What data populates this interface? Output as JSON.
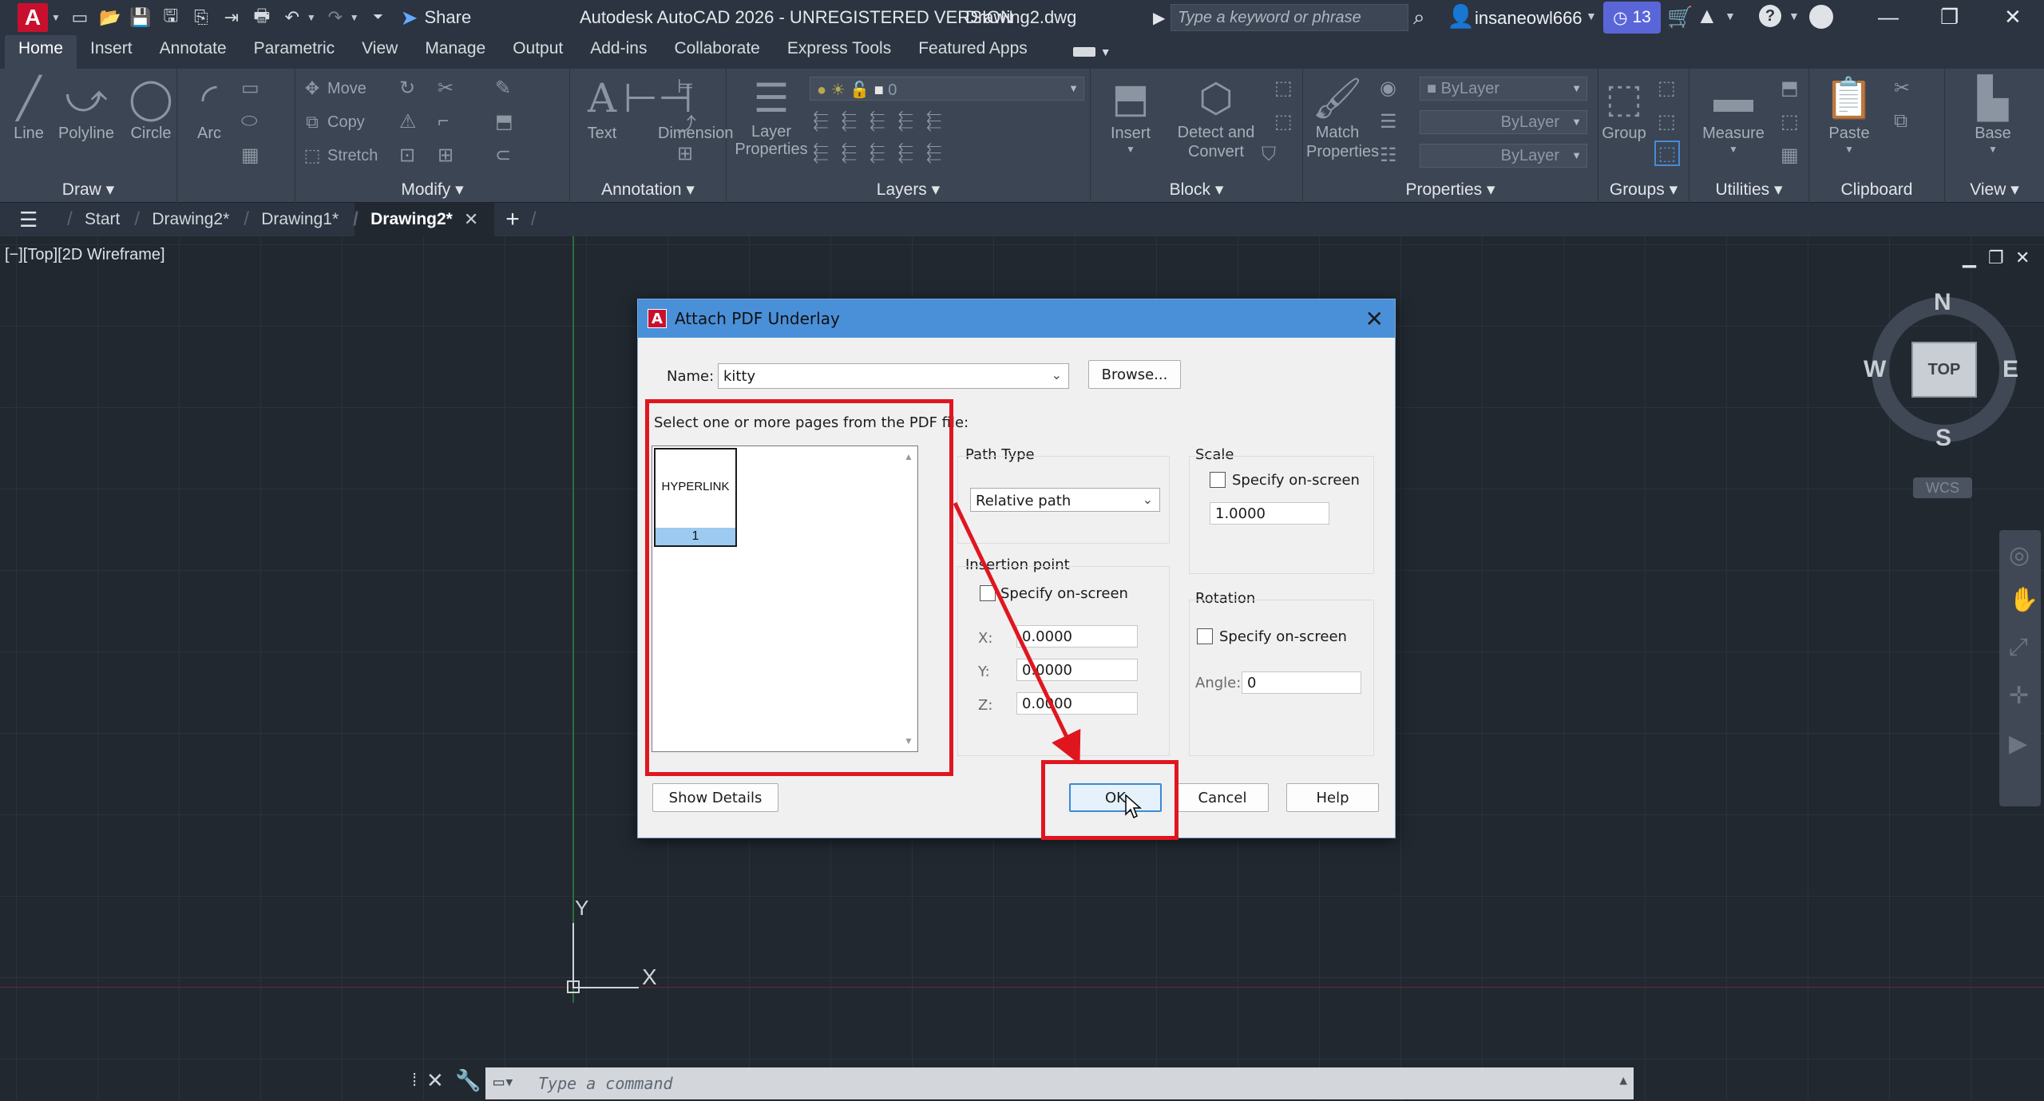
{
  "titlebar": {
    "share_label": "Share",
    "app_title": "Autodesk AutoCAD 2026 - UNREGISTERED VERSION",
    "doc_title": "Drawing2.dwg",
    "search_placeholder": "Type a keyword or phrase",
    "user_name": "insaneowl666",
    "notification_count": "13"
  },
  "ribbon_tabs": [
    "Home",
    "Insert",
    "Annotate",
    "Parametric",
    "View",
    "Manage",
    "Output",
    "Add-ins",
    "Collaborate",
    "Express Tools",
    "Featured Apps"
  ],
  "active_ribbon_tab": "Home",
  "ribbon": {
    "draw": {
      "label": "Draw",
      "tools": [
        "Line",
        "Polyline",
        "Circle",
        "Arc"
      ]
    },
    "modify": {
      "label": "Modify",
      "tools": [
        "Move",
        "Copy",
        "Stretch"
      ]
    },
    "annotation": {
      "label": "Annotation",
      "tools": [
        "Text",
        "Dimension"
      ]
    },
    "layers": {
      "label": "Layers",
      "tool": "Layer",
      "tool2": "Properties",
      "layer_value": "0"
    },
    "block": {
      "label": "Block",
      "insert": "Insert",
      "detect": "Detect and",
      "detect2": "Convert"
    },
    "properties": {
      "label": "Properties",
      "match": "Match",
      "match2": "Properties",
      "bylayer1": "ByLayer",
      "bylayer2": "ByLayer",
      "bylayer3": "ByLayer"
    },
    "groups": {
      "label": "Groups",
      "tool": "Group"
    },
    "utilities": {
      "label": "Utilities",
      "tool": "Measure"
    },
    "clipboard": {
      "label": "Clipboard",
      "tool": "Paste"
    },
    "view": {
      "label": "View",
      "tool": "Base"
    }
  },
  "doc_tabs": {
    "start": "Start",
    "tabs": [
      "Drawing2*",
      "Drawing1*",
      "Drawing2*"
    ],
    "active_index": 2
  },
  "viewport": {
    "label": "[−][Top][2D Wireframe]",
    "ucs_y": "Y",
    "ucs_x": "X",
    "viewcube": {
      "top": "TOP",
      "n": "N",
      "s": "S",
      "e": "E",
      "w": "W",
      "wcs": "WCS"
    }
  },
  "command_line": {
    "placeholder": "Type a command"
  },
  "dialog": {
    "title": "Attach PDF Underlay",
    "name_label": "Name:",
    "name_value": "kitty",
    "browse_label": "Browse...",
    "pages_label": "Select one or more pages from the PDF file:",
    "page_thumb_text": "HYPERLINK",
    "page_number": "1",
    "path_type_label": "Path Type",
    "path_type_value": "Relative path",
    "scale_label": "Scale",
    "scale_specify": "Specify on-screen",
    "scale_value": "1.0000",
    "insertion_label": "Insertion point",
    "insertion_specify": "Specify on-screen",
    "x_label": "X:",
    "x_value": "0.0000",
    "y_label": "Y:",
    "y_value": "0.0000",
    "z_label": "Z:",
    "z_value": "0.0000",
    "rotation_label": "Rotation",
    "rotation_specify": "Specify on-screen",
    "angle_label": "Angle:",
    "angle_value": "0",
    "show_details_label": "Show Details",
    "ok_label": "OK",
    "cancel_label": "Cancel",
    "help_label": "Help"
  },
  "colors": {
    "highlight": "#e0161f",
    "dialog_titlebar": "#4a90d9",
    "autocad_red": "#c8102e"
  }
}
